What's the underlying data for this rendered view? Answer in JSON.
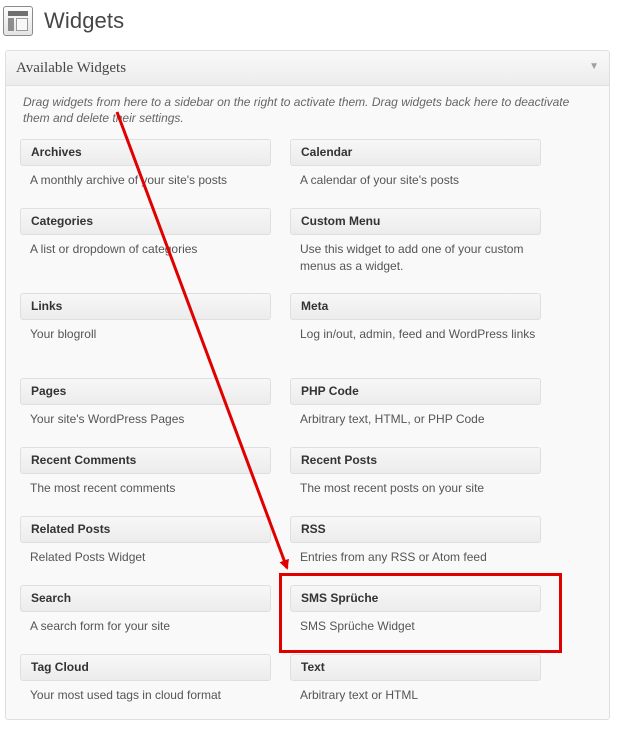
{
  "header": {
    "title": "Widgets",
    "icon": "widgets-icon"
  },
  "panel": {
    "title": "Available Widgets",
    "toggle_icon": "triangle-down-icon",
    "toggle_glyph": "▼",
    "description": "Drag widgets from here to a sidebar on the right to activate them. Drag widgets back here to deactivate them and delete their settings."
  },
  "widgets": [
    {
      "title": "Archives",
      "desc": "A monthly archive of your site's posts"
    },
    {
      "title": "Calendar",
      "desc": "A calendar of your site's posts"
    },
    {
      "title": "Categories",
      "desc": "A list or dropdown of categories"
    },
    {
      "title": "Custom Menu",
      "desc": "Use this widget to add one of your custom menus as a widget."
    },
    {
      "title": "Links",
      "desc": "Your blogroll"
    },
    {
      "title": "Meta",
      "desc": "Log in/out, admin, feed and WordPress links"
    },
    {
      "title": "Pages",
      "desc": "Your site's WordPress Pages"
    },
    {
      "title": "PHP Code",
      "desc": "Arbitrary text, HTML, or PHP Code"
    },
    {
      "title": "Recent Comments",
      "desc": "The most recent comments"
    },
    {
      "title": "Recent Posts",
      "desc": "The most recent posts on your site"
    },
    {
      "title": "Related Posts",
      "desc": "Related Posts Widget"
    },
    {
      "title": "RSS",
      "desc": "Entries from any RSS or Atom feed"
    },
    {
      "title": "Search",
      "desc": "A search form for your site"
    },
    {
      "title": "SMS Sprüche",
      "desc": "SMS Sprüche Widget"
    },
    {
      "title": "Tag Cloud",
      "desc": "Your most used tags in cloud format"
    },
    {
      "title": "Text",
      "desc": "Arbitrary text or HTML"
    }
  ],
  "annotation": {
    "color": "#e00000"
  }
}
